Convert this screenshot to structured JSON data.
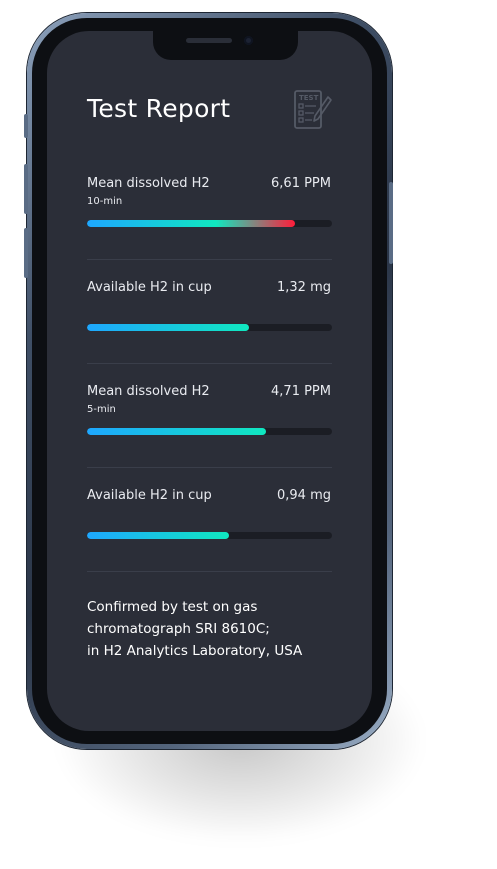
{
  "report": {
    "title": "Test Report",
    "icon": "test-checklist-icon",
    "icon_text": "TEST",
    "metrics": [
      {
        "label": "Mean dissolved H2",
        "sublabel": "10-min",
        "value": "6,61 PPM",
        "fill_fraction": 0.85,
        "gradient": [
          "#1ea7ff",
          "#10e8c0",
          "#ff1d3a"
        ]
      },
      {
        "label": "Available H2 in cup",
        "sublabel": "",
        "value": "1,32 mg",
        "fill_fraction": 0.66,
        "gradient": [
          "#1ea7ff",
          "#10e8c0"
        ]
      },
      {
        "label": "Mean dissolved H2",
        "sublabel": "5-min",
        "value": "4,71 PPM",
        "fill_fraction": 0.73,
        "gradient": [
          "#1ea7ff",
          "#10e8c0"
        ]
      },
      {
        "label": "Available H2 in cup",
        "sublabel": "",
        "value": "0,94 mg",
        "fill_fraction": 0.58,
        "gradient": [
          "#1ea7ff",
          "#10e8c0"
        ]
      }
    ],
    "footnote_lines": [
      "Confirmed by test on gas",
      "chromatograph SRI 8610C;",
      "in H2 Analytics Laboratory, USA"
    ]
  },
  "colors": {
    "screen_bg": "#2b2e38",
    "text": "#e9ebf0",
    "track": "#1b1d24",
    "accent_blue": "#1ea7ff",
    "accent_teal": "#10e8c0",
    "accent_red": "#ff1d3a"
  }
}
